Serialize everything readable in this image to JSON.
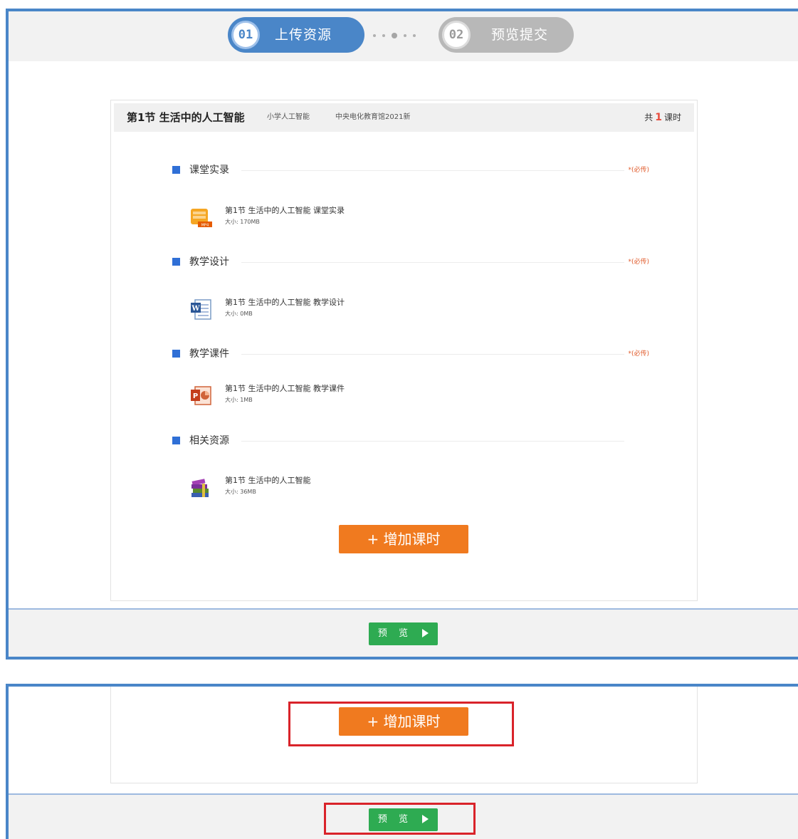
{
  "stepper": {
    "steps": [
      {
        "number": "01",
        "label": "上传资源",
        "state": "active"
      },
      {
        "number": "02",
        "label": "预览提交",
        "state": "inactive"
      }
    ]
  },
  "lesson": {
    "title": "第1节 生活中的人工智能",
    "subject": "小学人工智能",
    "publisher": "中央电化教育馆2021新",
    "count_prefix": "共",
    "count": "1",
    "count_suffix": "课时",
    "sections": [
      {
        "title": "课堂实录",
        "required": "*(必传)",
        "file": {
          "name": "第1节 生活中的人工智能 课堂实录",
          "size": "大小: 170MB",
          "icon": "mp4-video-icon"
        }
      },
      {
        "title": "教学设计",
        "required": "*(必传)",
        "file": {
          "name": "第1节 生活中的人工智能 教学设计",
          "size": "大小: 0MB",
          "icon": "word-document-icon"
        }
      },
      {
        "title": "教学课件",
        "required": "*(必传)",
        "file": {
          "name": "第1节 生活中的人工智能 教学课件",
          "size": "大小: 1MB",
          "icon": "powerpoint-icon"
        }
      },
      {
        "title": "相关资源",
        "required": "",
        "file": {
          "name": "第1节 生活中的人工智能",
          "size": "大小: 36MB",
          "icon": "archive-books-icon"
        }
      }
    ]
  },
  "actions": {
    "add_lesson": "+ 增加课时",
    "preview": "预 览"
  },
  "colors": {
    "primary_blue": "#4a86c8",
    "add_button_orange": "#f07a1f",
    "preview_button_green": "#2eab52",
    "required_red": "#e05a2a",
    "highlight_red": "#d9232a"
  }
}
